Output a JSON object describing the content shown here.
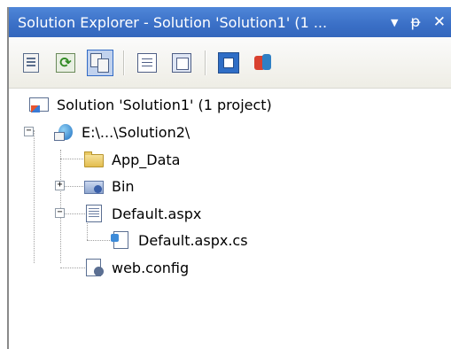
{
  "window": {
    "title": "Solution Explorer - Solution 'Solution1' (1 ...",
    "buttons": {
      "dropdown": "▼",
      "pin": "ᵽ",
      "close": "✕"
    }
  },
  "toolbar": {
    "items": [
      {
        "icon": "properties-icon"
      },
      {
        "icon": "refresh-icon"
      },
      {
        "icon": "show-all-files-icon",
        "pressed": true
      },
      {
        "icon": "view-code-icon"
      },
      {
        "icon": "view-designer-icon"
      },
      {
        "icon": "copy-website-icon"
      },
      {
        "icon": "asp-net-configuration-icon"
      }
    ]
  },
  "tree": {
    "solution": {
      "label": "Solution 'Solution1' (1 project)",
      "icon": "solution-icon"
    },
    "project": {
      "label": "E:\\...\\Solution2\\",
      "icon": "web-project-icon",
      "expanded": true
    },
    "items": [
      {
        "label": "App_Data",
        "icon": "folder-icon"
      },
      {
        "label": "Bin",
        "icon": "bin-folder-icon",
        "expander": "+"
      },
      {
        "label": "Default.aspx",
        "icon": "aspx-file-icon",
        "expander": "−"
      },
      {
        "label": "Default.aspx.cs",
        "icon": "cs-file-icon"
      },
      {
        "label": "web.config",
        "icon": "config-file-icon"
      }
    ],
    "expander_minus": "−"
  }
}
